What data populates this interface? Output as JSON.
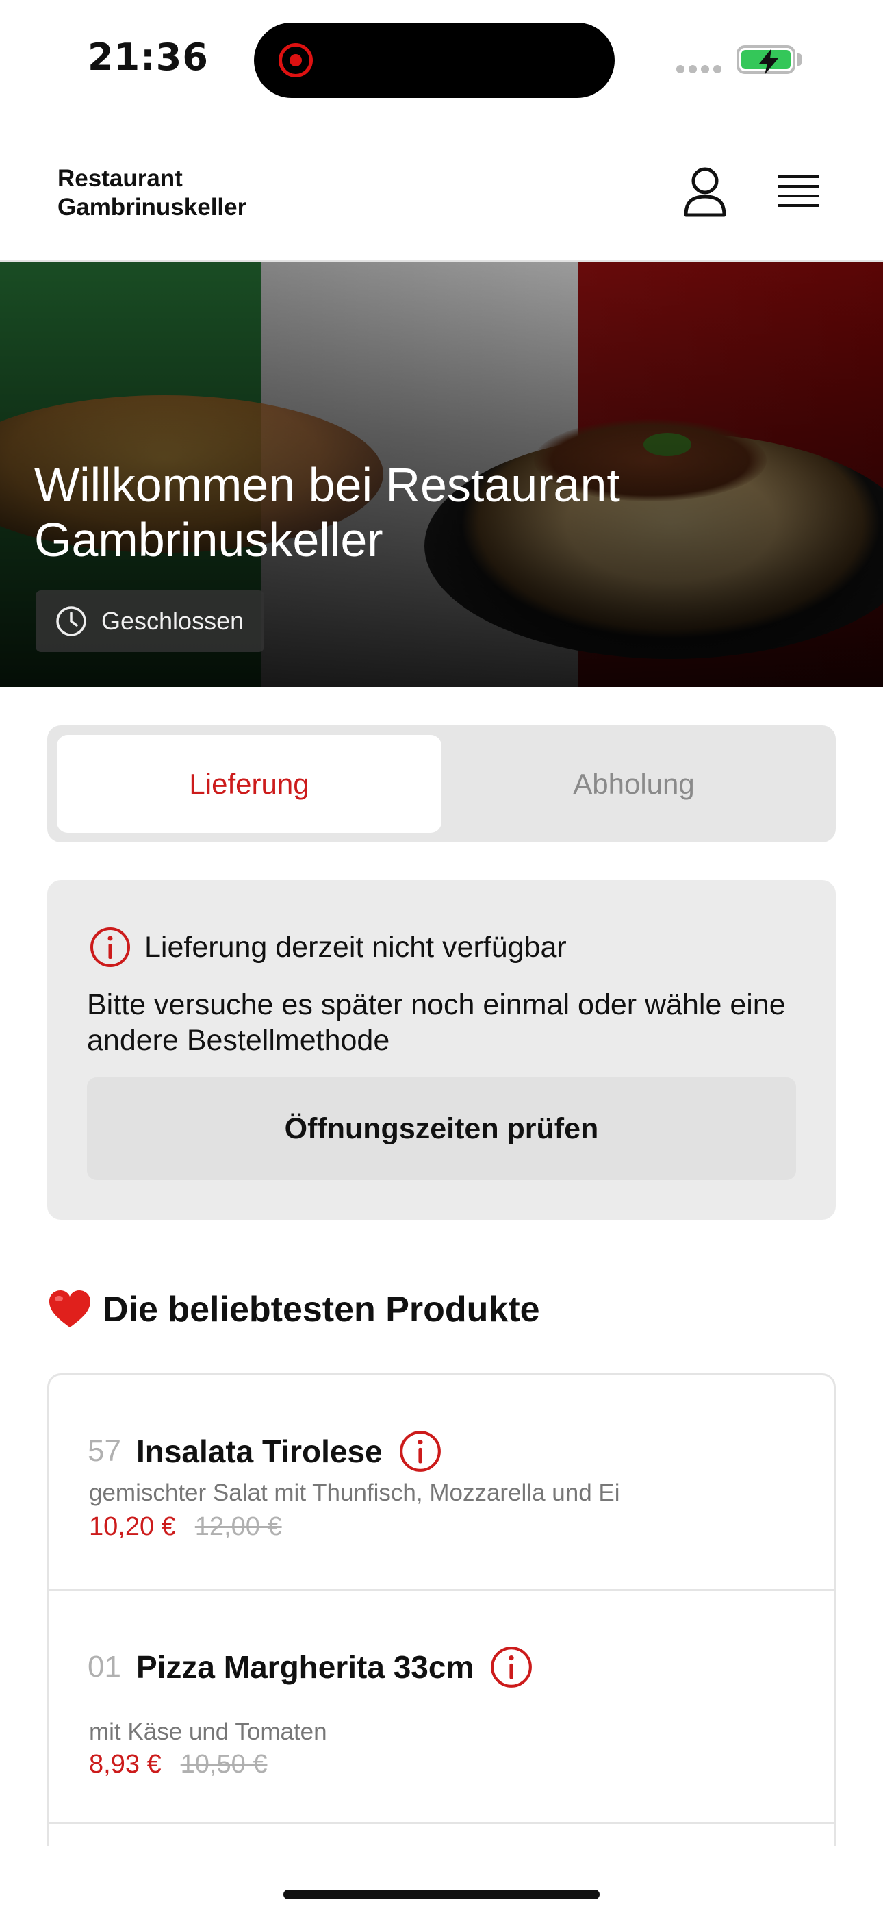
{
  "status_bar": {
    "time": "21:36",
    "battery_icon": "battery-charging-icon",
    "battery_color": "#34c759",
    "recording_color": "#dd1111"
  },
  "header": {
    "brand": "Restaurant Gambrinuskeller",
    "user_icon": "user-icon",
    "menu_icon": "hamburger-menu-icon"
  },
  "hero": {
    "title": "Willkommen bei Restaurant Gambrinuskeller",
    "status": "Geschlossen",
    "status_icon": "clock-icon"
  },
  "order_method": {
    "options": [
      "Lieferung",
      "Abholung"
    ],
    "selected": "Lieferung",
    "accent_color": "#cc1b1b"
  },
  "alert": {
    "icon": "info-icon",
    "title": "Lieferung derzeit nicht verfügbar",
    "body": "Bitte versuche es später noch einmal oder wähle eine andere Bestellmethode",
    "button": "Öffnungszeiten prüfen"
  },
  "popular": {
    "emoji": "❤️",
    "title": "Die beliebtesten Produkte",
    "products": [
      {
        "number": "57",
        "name": "Insalata Tirolese",
        "description": "gemischter Salat mit Thunfisch, Mozzarella und Ei",
        "price": "10,20 €",
        "old_price": "12,00 €"
      },
      {
        "number": "01",
        "name": "Pizza Margherita 33cm",
        "description": "mit Käse und Tomaten",
        "price": "8,93 €",
        "old_price": "10,50 €"
      }
    ]
  }
}
